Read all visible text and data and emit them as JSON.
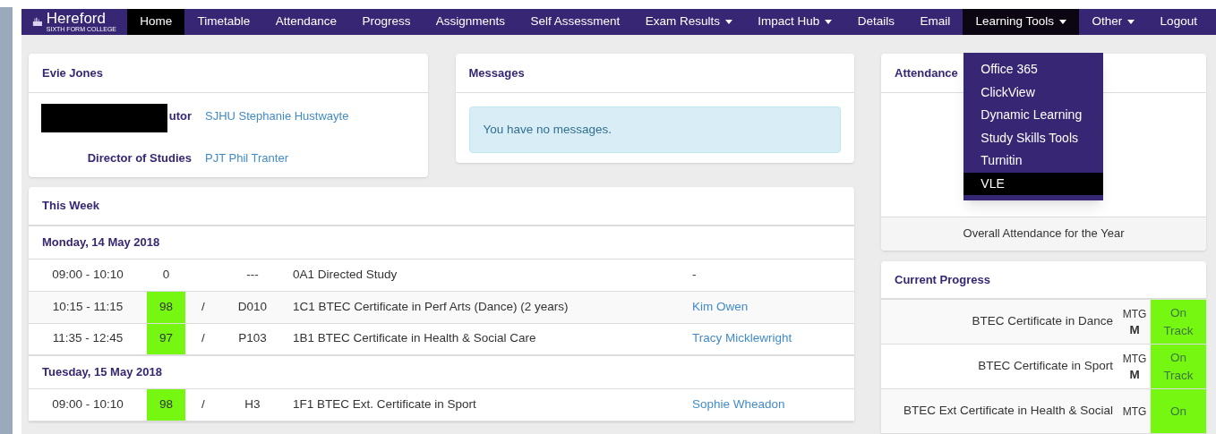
{
  "brand": {
    "name": "Hereford",
    "tagline": "SIXTH FORM COLLEGE"
  },
  "nav": [
    {
      "label": "Home",
      "selected": true,
      "dropdown": false
    },
    {
      "label": "Timetable",
      "selected": false,
      "dropdown": false
    },
    {
      "label": "Attendance",
      "selected": false,
      "dropdown": false
    },
    {
      "label": "Progress",
      "selected": false,
      "dropdown": false
    },
    {
      "label": "Assignments",
      "selected": false,
      "dropdown": false
    },
    {
      "label": "Self Assessment",
      "selected": false,
      "dropdown": false
    },
    {
      "label": "Exam Results",
      "selected": false,
      "dropdown": true
    },
    {
      "label": "Impact Hub",
      "selected": false,
      "dropdown": true
    },
    {
      "label": "Details",
      "selected": false,
      "dropdown": false
    },
    {
      "label": "Email",
      "selected": false,
      "dropdown": false
    },
    {
      "label": "Learning Tools",
      "selected": false,
      "dropdown": true,
      "expanded": true,
      "menu": [
        {
          "label": "Office 365",
          "selected": false
        },
        {
          "label": "ClickView",
          "selected": false
        },
        {
          "label": "Dynamic Learning",
          "selected": false
        },
        {
          "label": "Study Skills Tools",
          "selected": false
        },
        {
          "label": "Turnitin",
          "selected": false
        },
        {
          "label": "VLE",
          "selected": true
        }
      ]
    },
    {
      "label": "Other",
      "selected": false,
      "dropdown": true
    },
    {
      "label": "Logout",
      "selected": false,
      "dropdown": false
    }
  ],
  "profile": {
    "title": "Evie Jones",
    "rows": [
      {
        "label": "utor",
        "value": "SJHU Stephanie Hustwayte",
        "redacted": true
      },
      {
        "label": "Director of Studies",
        "value": "PJT Phil Tranter",
        "redacted": false
      }
    ]
  },
  "messages": {
    "title": "Messages",
    "alert": "You have no messages."
  },
  "this_week": {
    "title": "This Week",
    "days": [
      {
        "date": "Monday, 14 May 2018",
        "lessons": [
          {
            "time": "09:00 - 10:10",
            "mark": "0",
            "highlight": false,
            "room": "---",
            "class": "0A1 Directed Study",
            "teacher": "-",
            "link": false
          },
          {
            "time": "10:15 - 11:15",
            "mark": "98",
            "highlight": true,
            "separator": "/",
            "room": "D010",
            "class": "1C1 BTEC Certificate in Perf Arts (Dance) (2 years)",
            "teacher": "Kim Owen",
            "link": true
          },
          {
            "time": "11:35 - 12:45",
            "mark": "97",
            "highlight": true,
            "separator": "/",
            "room": "P103",
            "class": "1B1 BTEC Certificate in Health & Social Care",
            "teacher": "Tracy Micklewright",
            "link": true
          }
        ]
      },
      {
        "date": "Tuesday, 15 May 2018",
        "lessons": [
          {
            "time": "09:00 - 10:10",
            "mark": "98",
            "highlight": true,
            "separator": "/",
            "room": "H3",
            "class": "1F1 BTEC Ext. Certificate in Sport",
            "teacher": "Sophie Wheadon",
            "link": true
          }
        ]
      }
    ]
  },
  "attendance": {
    "title": "Attendance",
    "footer": "Overall Attendance for the Year"
  },
  "current_progress": {
    "title": "Current Progress",
    "rows": [
      {
        "course": "BTEC Certificate in Dance",
        "target_label": "MTG",
        "grade": "M",
        "status": "On Track",
        "color": "#76f712"
      },
      {
        "course": "BTEC Certificate in Sport",
        "target_label": "MTG",
        "grade": "M",
        "status": "On Track",
        "color": "#76f712"
      },
      {
        "course": "BTEC Ext Certificate in Health & Social",
        "target_label": "MTG",
        "status": "On",
        "color": "#76f712"
      }
    ]
  }
}
